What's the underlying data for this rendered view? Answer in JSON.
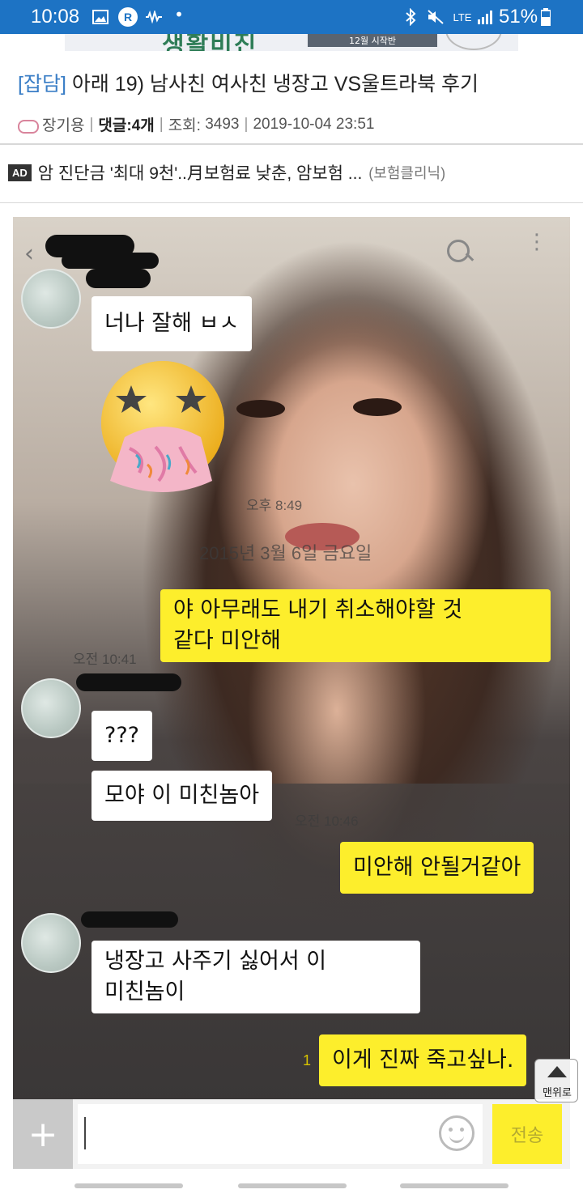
{
  "status_bar": {
    "time": "10:08",
    "network": "LTE",
    "battery": "51%",
    "icons": [
      "gallery-icon",
      "r-app-icon",
      "wave-icon",
      "dot-icon",
      "bluetooth-icon",
      "mute-icon",
      "lte-icon",
      "signal-icon",
      "battery-icon"
    ],
    "background_color": "#1d73c4"
  },
  "banner": {
    "text": "생활비진",
    "subtext": "12월 시작반"
  },
  "post": {
    "category": "[잡담]",
    "title": " 아래 19) 남사친 여사친 냉장고 VS울트라북 후기",
    "author": "장기용",
    "comments_label": "댓글:",
    "comments_count": "4개",
    "views_label": "조회:",
    "views": "3493",
    "datetime": "2019-10-04 23:51",
    "category_color": "#3a7ec6"
  },
  "ad": {
    "badge": "AD",
    "text": "암 진단금 '최대 9천'..月보험료 낮춘, 암보험 ...",
    "source": "(보험클리닉)"
  },
  "chat": {
    "date_separator": "2015년 3월 6일 금요일",
    "messages": [
      {
        "side": "in",
        "text": "너나 잘해 ㅂㅅ"
      },
      {
        "side": "in",
        "type": "emoji",
        "emoji": "vomiting-star-eyes-emoji"
      },
      {
        "side": "in",
        "time": "오후 8:49"
      },
      {
        "side": "out",
        "text_line1": "야 아무래도 내기 취소해야할 것",
        "text_line2": "같다 미안해",
        "time": "오전 10:41"
      },
      {
        "side": "in",
        "text": "???"
      },
      {
        "side": "in",
        "text": "모야 이 미친놈아",
        "time": "오전 10:46"
      },
      {
        "side": "out",
        "text": "미안해 안될거같아"
      },
      {
        "side": "in",
        "text_line1": "냉장고 사주기 싫어서 이",
        "text_line2": "미친놈이"
      },
      {
        "side": "out",
        "text": "이게 진짜 죽고싶나.",
        "unread": "1"
      }
    ],
    "send_label": "전송",
    "bubble_colors": {
      "in": "#ffffff",
      "out": "#fdee2c"
    }
  },
  "scroll_top_label": "맨위로"
}
